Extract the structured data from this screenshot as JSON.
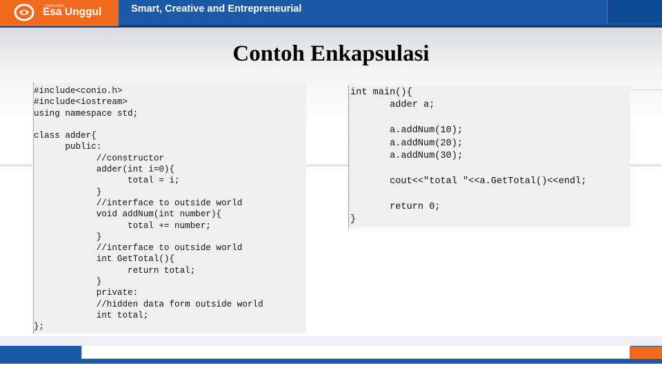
{
  "header": {
    "logo_small": "Universitas",
    "logo_text": "Esa Unggul",
    "tagline": "Smart, Creative and Entrepreneurial"
  },
  "slide": {
    "title": "Contoh Enkapsulasi"
  },
  "code_left": [
    "#include<conio.h>",
    "#include<iostream>",
    "using namespace std;",
    "",
    "class adder{",
    "      public:",
    "            //constructor",
    "            adder(int i=0){",
    "                  total = i;",
    "            }",
    "            //interface to outside world",
    "            void addNum(int number){",
    "                  total += number;",
    "            }",
    "            //interface to outside world",
    "            int GetTotal(){",
    "                  return total;",
    "            }",
    "            private:",
    "            //hidden data form outside world",
    "            int total;",
    "};"
  ],
  "code_right": [
    "int main(){",
    "       adder a;",
    "",
    "       a.addNum(10);",
    "       a.addNum(20);",
    "       a.addNum(30);",
    "",
    "       cout<<\"total \"<<a.GetTotal()<<endl;",
    "",
    "       return 0;",
    "}"
  ],
  "colors": {
    "header_blue": "#1c5aa8",
    "brand_orange": "#ef6a1d",
    "code_bg": "#f0f0f0"
  },
  "icons": {
    "logo": "esa-unggul-logo-icon"
  }
}
